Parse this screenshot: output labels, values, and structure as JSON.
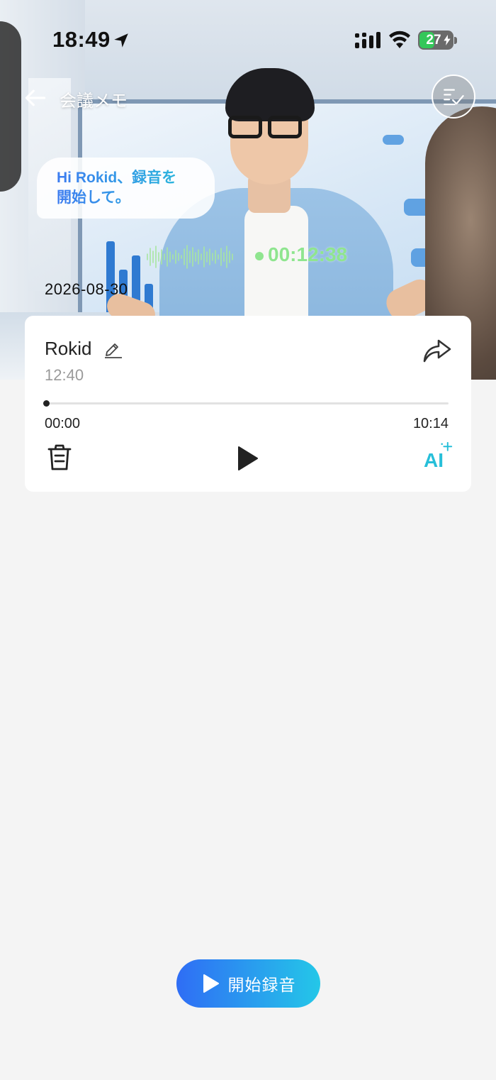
{
  "status_bar": {
    "time": "18:49",
    "battery": "27"
  },
  "header": {
    "title": "会議メモ"
  },
  "voice_bubble": {
    "line1": "Hi Rokid、録音を",
    "line2": "開始して。"
  },
  "recording": {
    "timer": "00:12:38"
  },
  "date": "2026-08-30",
  "record_card": {
    "name": "Rokid",
    "time": "12:40",
    "progress_fraction": 0,
    "position_label": "00:00",
    "duration_label": "10:14",
    "ai_label": "AI"
  },
  "start_button": {
    "label": "開始録音"
  },
  "colors": {
    "accent_blue": "#2f6df5",
    "accent_cyan": "#24c7e8",
    "timer_green": "#8fe58f",
    "page_background": "#f4f4f4"
  }
}
